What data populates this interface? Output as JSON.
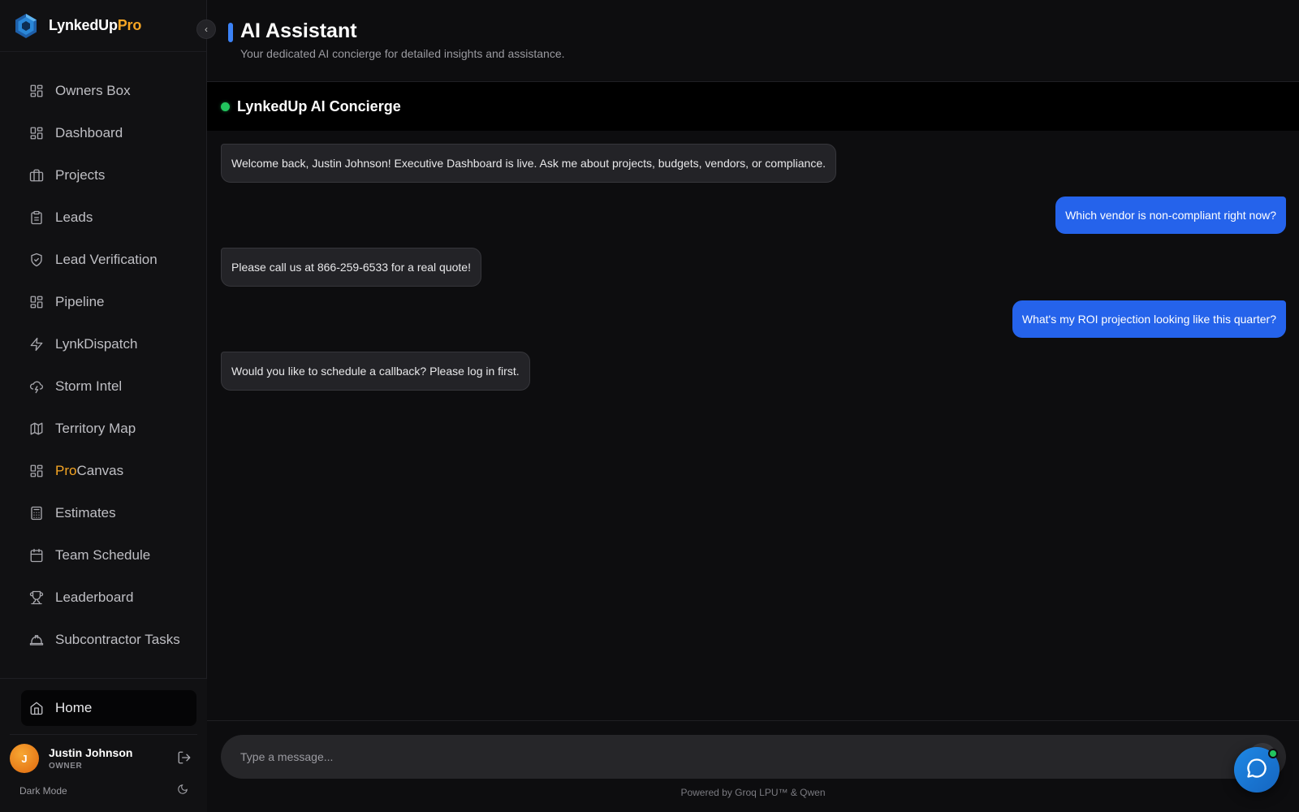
{
  "brand": {
    "name_main": "LynkedUp",
    "name_accent": "Pro"
  },
  "sidebar": {
    "items": [
      {
        "label": "Owners Box",
        "icon": "grid-icon"
      },
      {
        "label": "Dashboard",
        "icon": "grid-icon"
      },
      {
        "label": "Projects",
        "icon": "briefcase-icon"
      },
      {
        "label": "Leads",
        "icon": "clipboard-icon"
      },
      {
        "label": "Lead Verification",
        "icon": "shield-check-icon"
      },
      {
        "label": "Pipeline",
        "icon": "grid-icon"
      },
      {
        "label": "LynkDispatch",
        "icon": "lightning-icon"
      },
      {
        "label": "Storm Intel",
        "icon": "storm-cloud-icon"
      },
      {
        "label": "Territory Map",
        "icon": "map-icon"
      },
      {
        "label_accent": "Pro",
        "label": "Canvas",
        "icon": "grid-icon"
      },
      {
        "label": "Estimates",
        "icon": "calculator-icon"
      },
      {
        "label": "Team Schedule",
        "icon": "calendar-icon"
      },
      {
        "label": "Leaderboard",
        "icon": "trophy-icon"
      },
      {
        "label": "Subcontractor Tasks",
        "icon": "hard-hat-icon"
      }
    ],
    "home_label": "Home",
    "user": {
      "initial": "J",
      "name": "Justin Johnson",
      "role": "OWNER"
    },
    "dark_mode_label": "Dark Mode"
  },
  "header": {
    "title": "AI Assistant",
    "subtitle": "Your dedicated AI concierge for detailed insights and assistance."
  },
  "chat": {
    "title": "LynkedUp AI Concierge",
    "status_color": "#22c55e",
    "messages": [
      {
        "role": "bot",
        "text": "Welcome back, Justin Johnson! Executive Dashboard is live. Ask me about projects, budgets, vendors, or compliance."
      },
      {
        "role": "user",
        "text": "Which vendor is non-compliant right now?"
      },
      {
        "role": "bot",
        "text": "Please call us at 866-259-6533 for a real quote!"
      },
      {
        "role": "user",
        "text": "What's my ROI projection looking like this quarter?"
      },
      {
        "role": "bot",
        "text": "Would you like to schedule a callback? Please log in first."
      }
    ],
    "input_placeholder": "Type a message...",
    "input_value": "",
    "powered_by": "Powered by Groq LPU™ & Qwen"
  },
  "colors": {
    "accent": "#3b82f6",
    "brand_pro": "#f5a524",
    "user_bubble": "#2563eb"
  }
}
